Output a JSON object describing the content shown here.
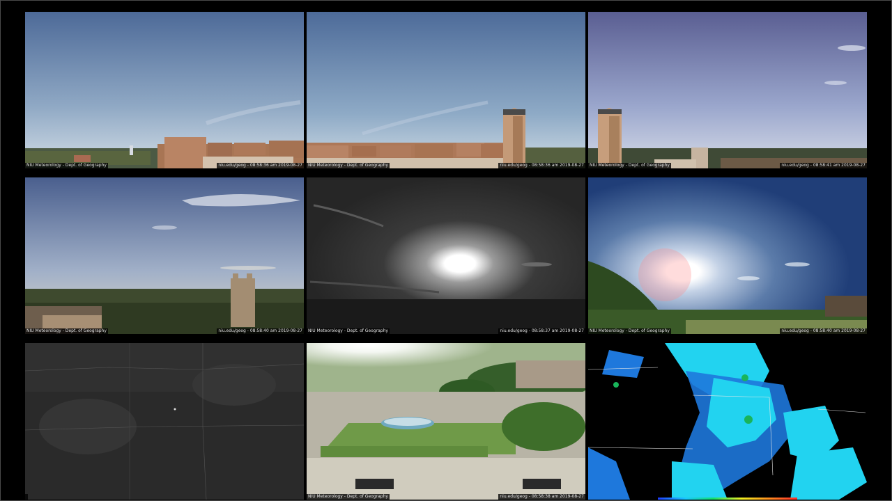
{
  "tiles": [
    {
      "name": "webcam-north",
      "caption_left": "NIU Meteorology - Dept. of Geography",
      "caption_right": "niu.edu/geog - 08:58:36 am 2019-08-27"
    },
    {
      "name": "webcam-northeast",
      "caption_left": "NIU Meteorology - Dept. of Geography",
      "caption_right": "niu.edu/geog - 08:58:36 am 2019-08-27"
    },
    {
      "name": "webcam-east",
      "caption_left": "NIU Meteorology - Dept. of Geography",
      "caption_right": "niu.edu/geog - 08:58:41 am 2019-08-27"
    },
    {
      "name": "webcam-west",
      "caption_left": "NIU Meteorology - Dept. of Geography",
      "caption_right": "niu.edu/geog - 08:58:40 am 2019-08-27"
    },
    {
      "name": "webcam-sun-mono",
      "caption_left": "NIU Meteorology - Dept. of Geography",
      "caption_right": "niu.edu/geog - 08:58:37 am 2019-08-27"
    },
    {
      "name": "webcam-sun-color",
      "caption_left": "NIU Meteorology - Dept. of Geography",
      "caption_right": "niu.edu/geog - 08:58:40 am 2019-08-27"
    },
    {
      "name": "satellite-visible",
      "caption_left": "",
      "caption_right": ""
    },
    {
      "name": "webcam-courtyard",
      "caption_left": "NIU Meteorology - Dept. of Geography",
      "caption_right": "niu.edu/geog - 08:58:38 am 2019-08-27"
    },
    {
      "name": "radar-mosaic",
      "caption_left": "",
      "caption_right": ""
    }
  ],
  "colors": {
    "background": "#000000",
    "sky_top": "#4f6b99",
    "sky_bottom": "#c9d7e4",
    "brick": "#b37e5c",
    "radar_cyan": "#22d3f0",
    "radar_blue": "#1e78dc",
    "radar_green": "#19b45a"
  }
}
